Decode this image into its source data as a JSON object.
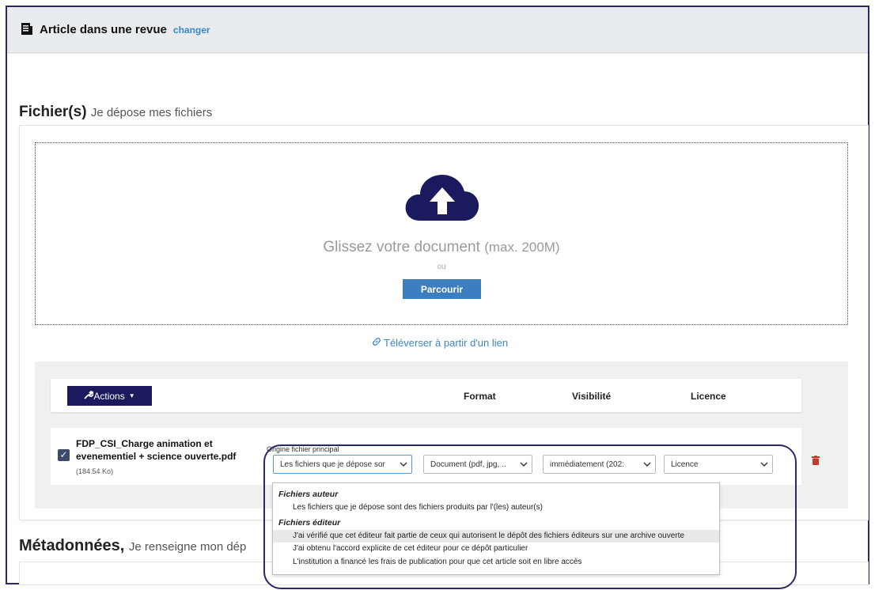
{
  "header": {
    "title": "Article dans une revue",
    "change_link": "changer"
  },
  "files_section": {
    "title": "Fichier(s)",
    "subtitle": "Je dépose mes fichiers"
  },
  "dropzone": {
    "text": "Glissez votre document",
    "max": "(max. 200M)",
    "or": "ou",
    "browse_label": "Parcourir"
  },
  "upload_link": "Téléverser à partir d'un lien",
  "table": {
    "actions_label": "Actions",
    "col_format": "Format",
    "col_visibility": "Visibilité",
    "col_license": "Licence"
  },
  "file": {
    "name": "FDP_CSI_Charge animation et evenementiel + science ouverte.pdf",
    "size": "(184.54 Ko)",
    "checked": true,
    "origin_label": "Origine fichier principal",
    "origin_value": "Les fichiers que je dépose sor",
    "format_value": "Document (pdf, jpg, ..",
    "visibility_value": "immédiatement (202:",
    "license_value": "Licence"
  },
  "dropdown": {
    "group1": "Fichiers auteur",
    "opt1": "Les fichiers que je dépose sont des fichiers produits par l'(les) auteur(s)",
    "group2": "Fichiers éditeur",
    "opt2": "J'ai vérifié que cet éditeur fait partie de ceux qui autorisent le dépôt des fichiers éditeurs sur une archive ouverte",
    "opt3": "J'ai obtenu l'accord explicite de cet éditeur pour ce dépôt particulier",
    "opt4": "L'institution a financé les frais de publication pour que cet article soit en libre accès"
  },
  "metadata_section": {
    "title": "Métadonnées,",
    "subtitle": "Je renseigne mon dép"
  },
  "colors": {
    "accent_navy": "#1c1a5e",
    "button_blue": "#3c7fc1",
    "link_blue": "#3d85c6",
    "delete_red": "#c0392b"
  }
}
